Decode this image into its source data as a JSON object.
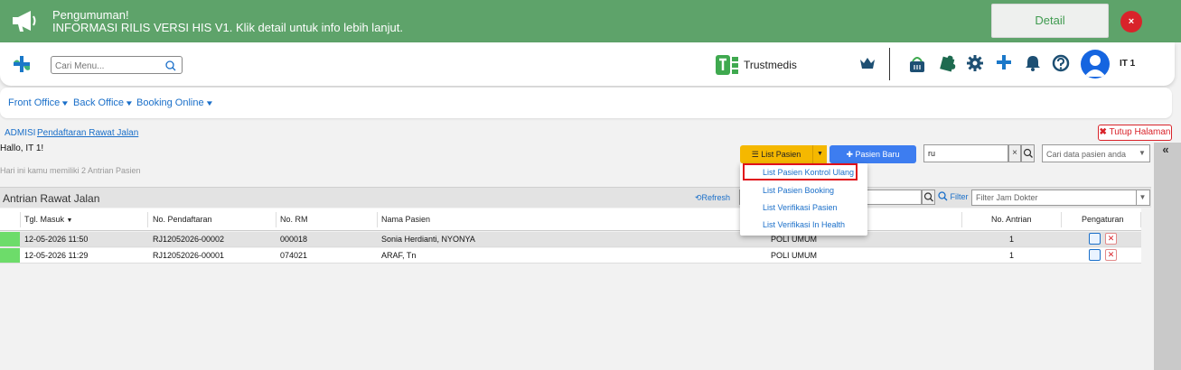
{
  "announcement": {
    "title": "Pengumuman!",
    "message": "INFORMASI RILIS VERSI HIS V1. Klik detail untuk info lebih lanjut.",
    "detail_label": "Detail",
    "close_label": "×",
    "bg_color": "#5ea36a"
  },
  "header": {
    "search_placeholder": "Cari Menu...",
    "brand": "Trustmedis",
    "user": "IT 1"
  },
  "nav": {
    "items": [
      {
        "label": "Front Office"
      },
      {
        "label": "Back Office"
      },
      {
        "label": "Booking Online"
      }
    ]
  },
  "breadcrumb": {
    "root": "ADMISI",
    "current": "Pendaftaran Rawat Jalan"
  },
  "close_page_label": "Tutup Halaman",
  "greeting": "Hallo, IT 1!",
  "info_text": "Hari ini kamu memiliki 2 Antrian Pasien",
  "actions": {
    "list_pasien": "List Pasien",
    "pasien_baru": "Pasien Baru",
    "search_value": "ru",
    "search_placeholder": "Cari data pasien anda"
  },
  "dropdown": {
    "items": [
      "List Pasien Kontrol Ulang",
      "List Pasien Booking",
      "List Verifikasi Pasien",
      "List Verifikasi In Health"
    ],
    "highlighted": "List Pasien Kontrol Ulang"
  },
  "queue": {
    "title": "Antrian Rawat Jalan",
    "refresh_label": "Refresh",
    "filter_label": "Filter",
    "jam_dokter_placeholder": "Filter Jam Dokter",
    "columns": [
      "Tgl. Masuk",
      "No. Pendaftaran",
      "No. RM",
      "Nama Pasien",
      "No. Antrian",
      "Pengaturan"
    ],
    "rows": [
      {
        "tgl": "12-05-2026 11:50",
        "no_pendaftaran": "RJ12052026-00002",
        "no_rm": "000018",
        "nama": "Sonia Herdianti, NYONYA",
        "poli": "POLI UMUM",
        "antrian": "1"
      },
      {
        "tgl": "12-05-2026 11:29",
        "no_pendaftaran": "RJ12052026-00001",
        "no_rm": "074021",
        "nama": "ARAF, Tn",
        "poli": "POLI UMUM",
        "antrian": "1"
      }
    ]
  },
  "colors": {
    "accent_blue": "#1a6fc9",
    "list_button": "#f5b800",
    "new_button": "#3d7df0",
    "danger": "#d9232a",
    "status_green": "#6ddc6a"
  }
}
